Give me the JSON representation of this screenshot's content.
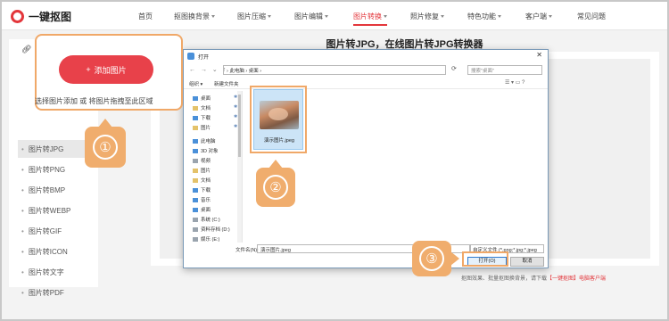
{
  "brand": {
    "name": "一键抠图"
  },
  "nav": {
    "items": [
      {
        "label": "首页",
        "dropdown": false
      },
      {
        "label": "抠图换背景",
        "dropdown": true
      },
      {
        "label": "图片压缩",
        "dropdown": true
      },
      {
        "label": "图片编辑",
        "dropdown": true
      },
      {
        "label": "图片转换",
        "dropdown": true,
        "active": true
      },
      {
        "label": "照片修复",
        "dropdown": true
      },
      {
        "label": "特色功能",
        "dropdown": true
      },
      {
        "label": "客户端",
        "dropdown": true
      },
      {
        "label": "常见问题",
        "dropdown": false
      }
    ]
  },
  "sidebar": {
    "items": [
      {
        "label": "图片转JPG",
        "active": true
      },
      {
        "label": "图片转PNG"
      },
      {
        "label": "图片转BMP"
      },
      {
        "label": "图片转WEBP"
      },
      {
        "label": "图片转GIF"
      },
      {
        "label": "图片转ICON"
      },
      {
        "label": "图片转文字"
      },
      {
        "label": "图片转PDF"
      }
    ]
  },
  "main": {
    "title": "图片转JPG，在线图片转JPG转换器",
    "footer_note_prefix": "抠图效果、批量抠图换背景，请下载",
    "footer_note_link": "【一键抠图】电脑客户端"
  },
  "upload": {
    "button_label": "添加图片",
    "hint": "选择图片添加 或 将图片拖拽至此区域"
  },
  "steps": [
    "①",
    "②",
    "③"
  ],
  "dialog": {
    "title": "打开",
    "address": "› 此电脑 › 桌面 ›",
    "search_placeholder": "搜索\"桌面\"",
    "organize_label": "组织 ▾",
    "new_folder_label": "新建文件夹",
    "tree": [
      {
        "label": "桌面",
        "icon": "folder-icon",
        "pinned": true
      },
      {
        "label": "文档",
        "icon": "folder-icon",
        "pinned": true
      },
      {
        "label": "下载",
        "icon": "download-icon",
        "pinned": true
      },
      {
        "label": "图片",
        "icon": "folder-icon",
        "pinned": true
      },
      {
        "label": "此电脑",
        "icon": "computer-icon"
      },
      {
        "label": "3D 对象",
        "icon": "folder-icon"
      },
      {
        "label": "视频",
        "icon": "folder-icon"
      },
      {
        "label": "图片",
        "icon": "folder-icon"
      },
      {
        "label": "文档",
        "icon": "folder-icon"
      },
      {
        "label": "下载",
        "icon": "download-icon"
      },
      {
        "label": "音乐",
        "icon": "music-icon"
      },
      {
        "label": "桌面",
        "icon": "folder-icon",
        "selected": true
      },
      {
        "label": "系统 (C:)",
        "icon": "drive-icon"
      },
      {
        "label": "资料存档 (D:)",
        "icon": "drive-icon"
      },
      {
        "label": "娱乐 (E:)",
        "icon": "drive-icon"
      }
    ],
    "file": {
      "name": "演示图片.jpeg"
    },
    "filename_label": "文件名(N):",
    "filename_value": "演示图片.jpeg",
    "filetype_value": "自定义文件 (*.png;*.jpg;*.jpeg",
    "open_label": "打开(O)",
    "cancel_label": "取消"
  }
}
